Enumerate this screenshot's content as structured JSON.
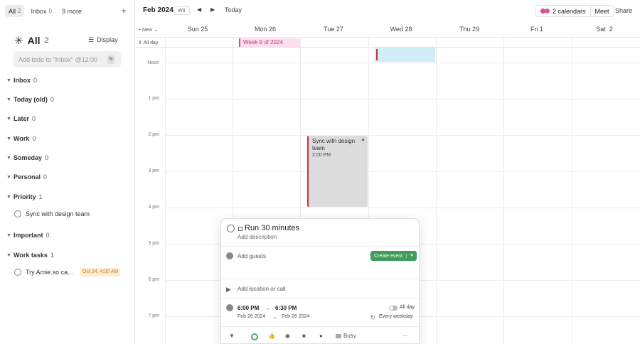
{
  "sidebar": {
    "tabs": [
      {
        "label": "All",
        "count": "2"
      },
      {
        "label": "Inbox",
        "count": "0"
      },
      {
        "label": "9 more",
        "count": ""
      }
    ],
    "heading": {
      "title": "All",
      "count": "2"
    },
    "display_label": "Display",
    "todo_placeholder": "Add todo to \"Inbox\" @12:00",
    "todo_key": "N",
    "groups": [
      {
        "name": "Inbox",
        "count": "0"
      },
      {
        "name": "Today (old)",
        "count": "0"
      },
      {
        "name": "Later",
        "count": "0"
      },
      {
        "name": "Work",
        "count": "0"
      },
      {
        "name": "Someday",
        "count": "0"
      },
      {
        "name": "Personal",
        "count": "0"
      },
      {
        "name": "Priority",
        "count": "1"
      },
      {
        "name": "Important",
        "count": "0"
      },
      {
        "name": "Work tasks",
        "count": "1"
      }
    ],
    "tasks": [
      {
        "title": "Sync with design team",
        "tag": ""
      },
      {
        "title": "Try Amie.so ca...",
        "tag": "Oct 24, 4:30 AM"
      }
    ]
  },
  "toolbar": {
    "month": "Feb 2024",
    "week": "W9",
    "today": "Today",
    "calendars": "2 calendars",
    "meet": "Meet",
    "share": "Share"
  },
  "day_header": {
    "new_label": "New",
    "days": [
      "Sun 25",
      "Mon 26",
      "Tue 27",
      "Wed 28",
      "Thu 29",
      "Fri  1",
      "Sat  2"
    ]
  },
  "grid": {
    "allday_label": "All day",
    "times": [
      "Noon",
      "1 pm",
      "2 pm",
      "3 pm",
      "4 pm",
      "5 pm",
      "6 pm",
      "7 pm"
    ]
  },
  "events": {
    "week_banner": "Week 9 of 2024",
    "sync_title": "Sync with design team",
    "sync_time": "2:00 PM"
  },
  "popup": {
    "title": "Run 30 minutes",
    "description": "Add description",
    "guests": "Add guests",
    "create_button": "Create event",
    "location": "Add location or call",
    "start_time": "6:00 PM",
    "end_time": "6:30 PM",
    "start_date": "Feb 26 2024",
    "end_date": "Feb 26 2024",
    "all_day": "All day",
    "repeat": "Every weekday",
    "busy": "Busy"
  },
  "colors": {
    "accent_green": "#3f9d58",
    "event_red": "#cc2d3a",
    "week_pink": "#d84aa0",
    "tag_orange": "#c77a1a"
  }
}
